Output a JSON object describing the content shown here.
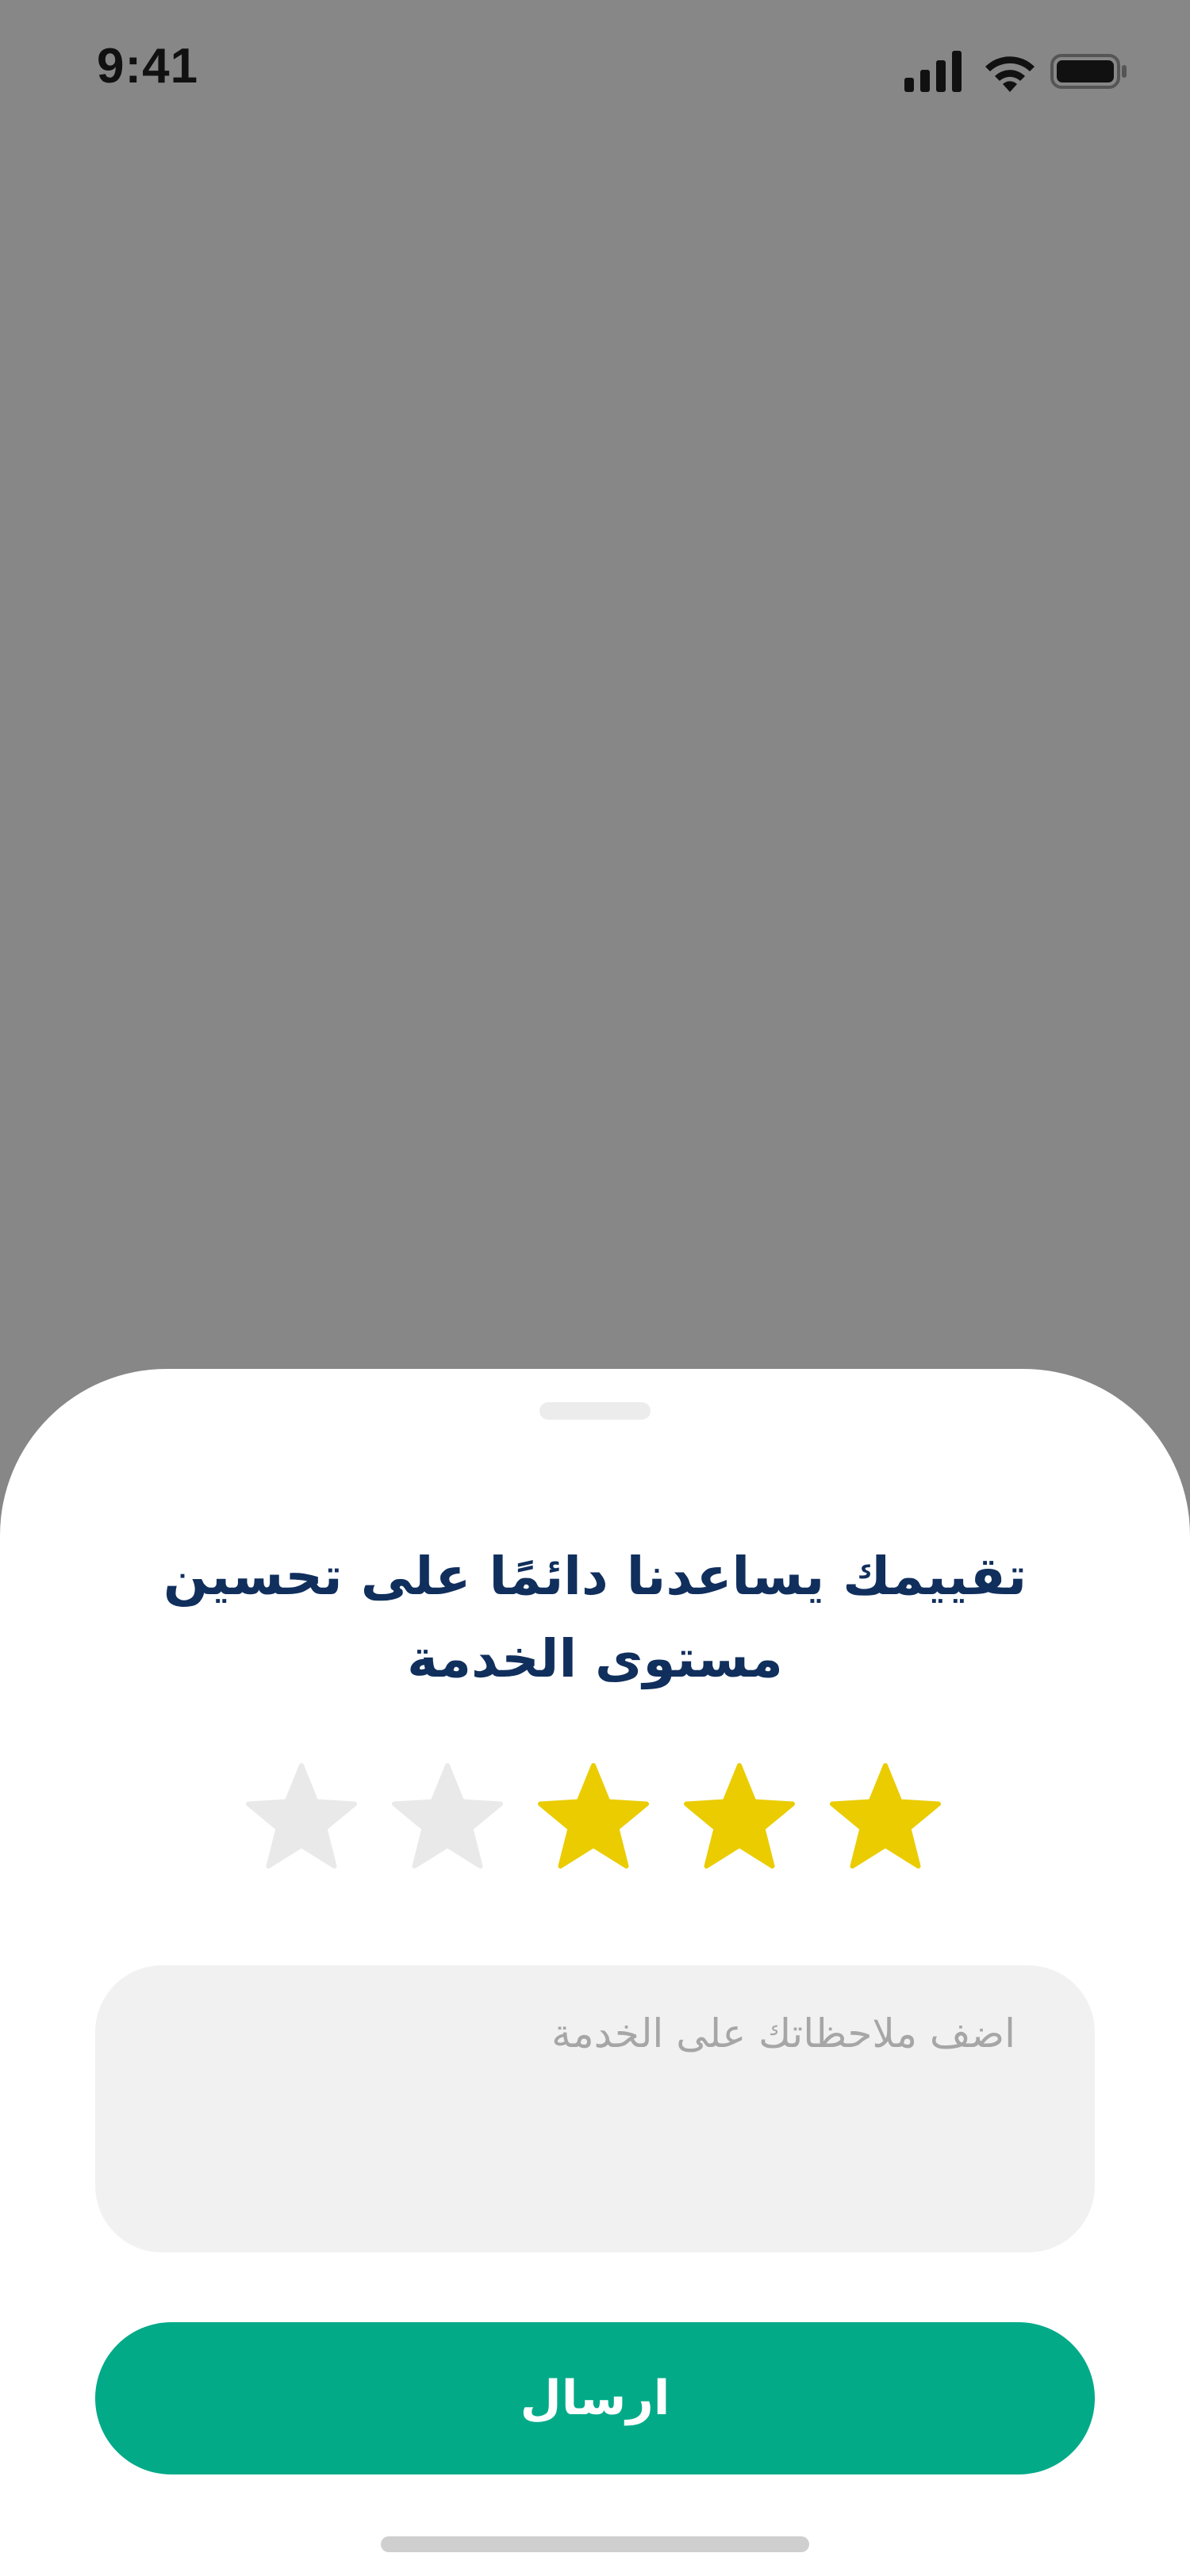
{
  "status_bar": {
    "time": "9:41",
    "icons": [
      "signal-icon",
      "wifi-icon",
      "battery-icon"
    ]
  },
  "rating_sheet": {
    "title": "تقييمك يساعدنا دائمًا على تحسين مستوى الخدمة",
    "rating": 3,
    "max_rating": 5,
    "star_filled_color": "#EACC00",
    "star_empty_color": "#E9E9E9",
    "feedback_placeholder": "اضف ملاحظاتك على الخدمة",
    "feedback_value": "",
    "submit_label": "ارسال",
    "submit_color": "#02AA88",
    "title_color": "#102F5C"
  }
}
